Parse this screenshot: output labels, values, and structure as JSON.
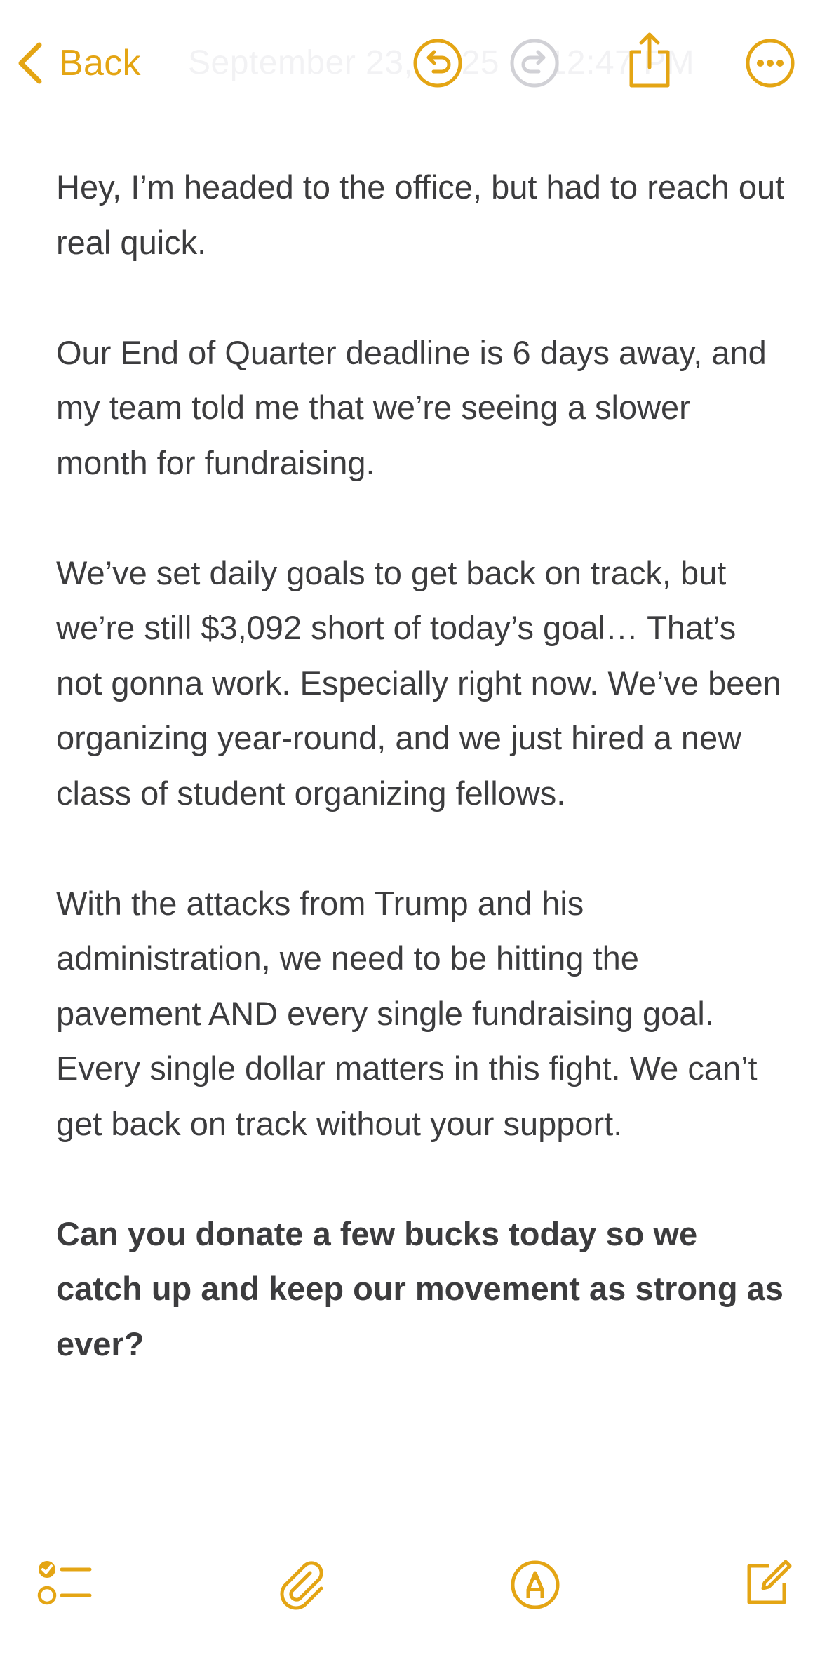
{
  "toolbar": {
    "back_label": "Back",
    "title": "September 23, 2025 at 12:47 PM",
    "accent_color": "#e4a514",
    "icons": [
      "chevron-left-icon",
      "undo-icon",
      "redo-icon",
      "share-icon",
      "more-icon"
    ]
  },
  "note": {
    "paragraphs": [
      "Hey, I’m headed to the office, but had to reach out real quick.",
      "Our End of Quarter deadline is 6 days away, and my team told me that we’re seeing a slower month for fundraising.",
      "We’ve set daily goals to get back on track, but we’re still $3,092 short of today’s goal… That’s not gonna work. Especially right now. We’ve been organizing year-round, and we just hired a new class of student organizing fellows.",
      "With the attacks from Trump and his administration, we need to be hitting the pavement AND every single fundraising goal. Every single dollar matters in this fight. We can’t get back on track without your support."
    ],
    "ask": "Can you donate a few bucks today so we catch up and keep our movement as strong as ever?"
  },
  "bottom_toolbar": {
    "icons": [
      "checklist-icon",
      "attachment-icon",
      "markup-icon",
      "compose-icon"
    ]
  }
}
